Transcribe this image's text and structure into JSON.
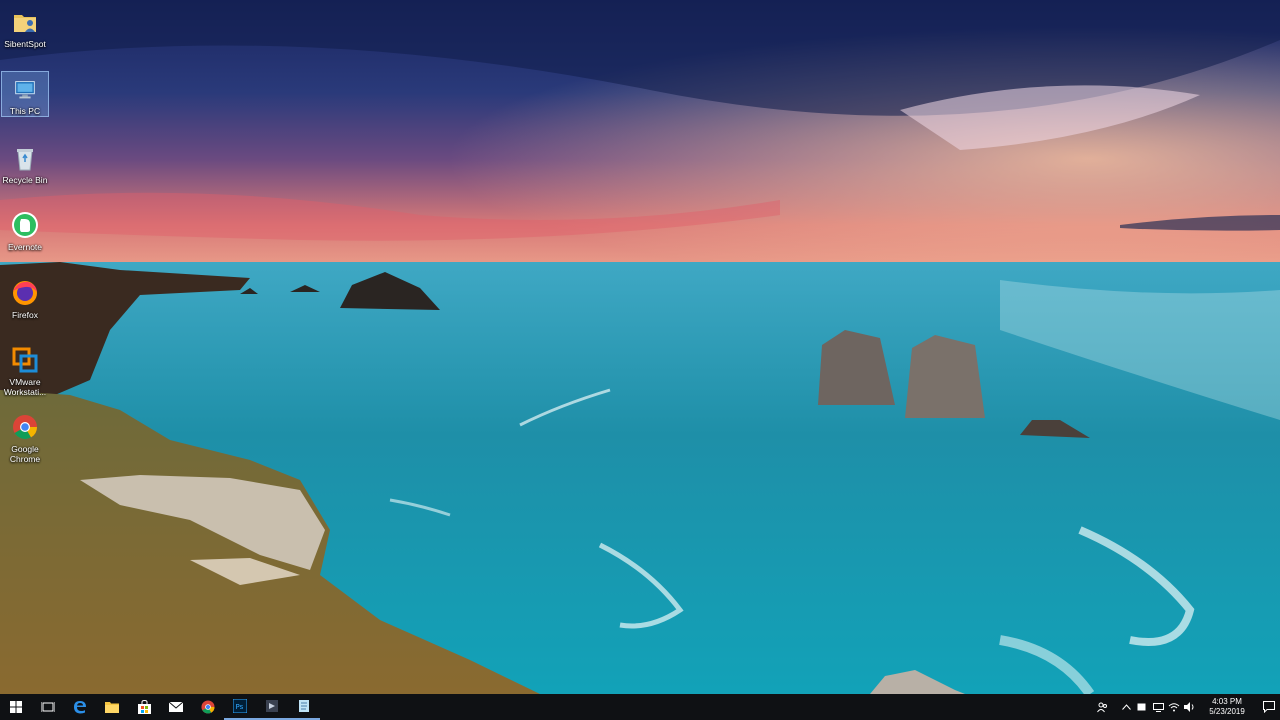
{
  "desktop": {
    "icons": [
      {
        "label": "SibentSpot",
        "icon": "folder-user-icon"
      },
      {
        "label": "This PC",
        "icon": "computer-icon",
        "selected": true
      },
      {
        "label": "Recycle Bin",
        "icon": "recycle-bin-icon"
      },
      {
        "label": "Evernote",
        "icon": "evernote-icon"
      },
      {
        "label": "Firefox",
        "icon": "firefox-icon"
      },
      {
        "label": "VMware Workstati...",
        "icon": "vmware-icon"
      },
      {
        "label": "Google Chrome",
        "icon": "chrome-icon"
      }
    ]
  },
  "taskbar": {
    "pinned": [
      "start-icon",
      "task-view-icon",
      "edge-icon",
      "file-explorer-icon",
      "store-icon",
      "mail-icon",
      "chrome-icon",
      "photoshop-icon",
      "app-icon",
      "notepad-icon"
    ],
    "clock": {
      "time": "4:03 PM",
      "date": "5/23/2019"
    }
  },
  "colors": {
    "taskbar": "#0f1114",
    "selection": "#78aae6"
  }
}
